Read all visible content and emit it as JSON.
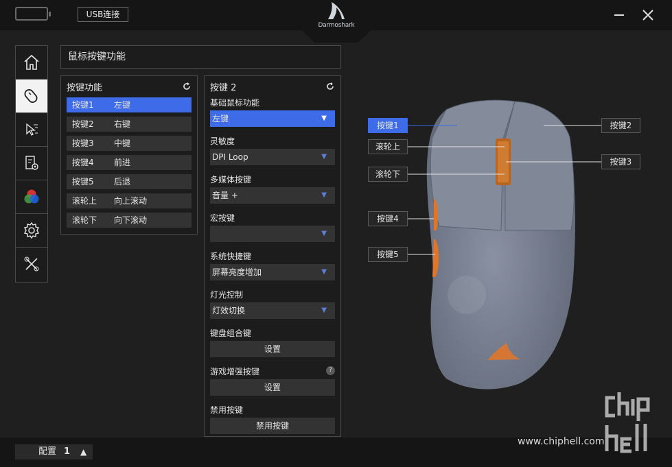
{
  "header": {
    "usb_label": "USB连接",
    "logo_text": "Darmoshark",
    "minimize_label": "minimize",
    "close_label": "close"
  },
  "sidebar": {
    "items": [
      {
        "icon": "home-icon"
      },
      {
        "icon": "mouse-icon",
        "active": true
      },
      {
        "icon": "macro-icon"
      },
      {
        "icon": "document-settings-icon"
      },
      {
        "icon": "rgb-lighting-icon"
      },
      {
        "icon": "gear-icon"
      },
      {
        "icon": "tools-icon"
      }
    ]
  },
  "main": {
    "title": "鼠标按键功能"
  },
  "key_panel": {
    "title": "按键功能",
    "rows": [
      {
        "key": "按键1",
        "func": "左键",
        "selected": true
      },
      {
        "key": "按键2",
        "func": "右键"
      },
      {
        "key": "按键3",
        "func": "中键"
      },
      {
        "key": "按键4",
        "func": "前进"
      },
      {
        "key": "按键5",
        "func": "后退"
      },
      {
        "key": "滚轮上",
        "func": "向上滚动"
      },
      {
        "key": "滚轮下",
        "func": "向下滚动"
      }
    ]
  },
  "config_panel": {
    "title": "按键 2",
    "basic_label": "基础鼠标功能",
    "basic_value": "左键",
    "sensitivity_label": "灵敏度",
    "sensitivity_value": "DPI Loop",
    "media_label": "多媒体按键",
    "media_value": "音量 +",
    "macro_label": "宏按键",
    "macro_value": "",
    "shortcut_label": "系统快捷键",
    "shortcut_value": "屏幕亮度增加",
    "light_label": "灯光控制",
    "light_value": "灯效切换",
    "combo_label": "键盘组合键",
    "combo_button": "设置",
    "game_label": "游戏增强按键",
    "game_button": "设置",
    "help_glyph": "?",
    "disable_label": "禁用按键",
    "disable_button": "禁用按键"
  },
  "callouts": {
    "k1": "按键1",
    "wheel_up": "滚轮上",
    "wheel_down": "滚轮下",
    "k4": "按键4",
    "k5": "按键5",
    "k2": "按键2",
    "k3": "按键3"
  },
  "footer": {
    "config_label": "配置",
    "config_number": "1",
    "watermark": "www.chiphell.com"
  },
  "colors": {
    "accent": "#3e6be8",
    "mouse_body": "#7c8394",
    "button_orange": "#e0762a"
  }
}
